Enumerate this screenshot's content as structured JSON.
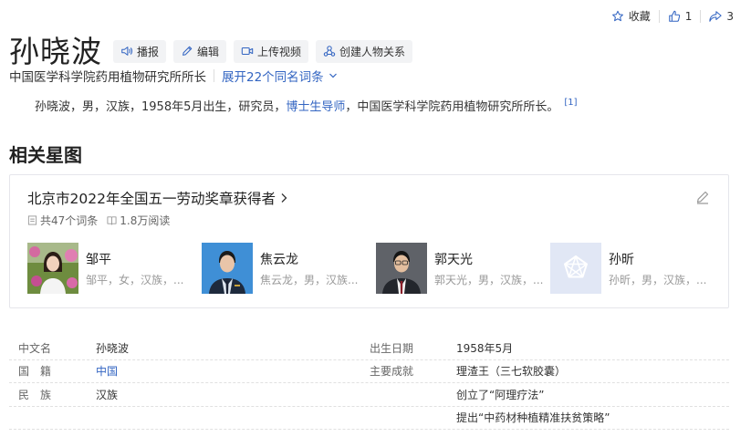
{
  "top_actions": {
    "favorite_label": "收藏",
    "like_count": "1",
    "share_count": "3"
  },
  "entry": {
    "title": "孙晓波",
    "subtitle": "中国医学科学院药用植物研究所所长",
    "expand_label": "展开22个同名词条"
  },
  "tools": [
    {
      "label": "播报",
      "icon": "speaker-icon"
    },
    {
      "label": "编辑",
      "icon": "pencil-icon"
    },
    {
      "label": "上传视频",
      "icon": "video-icon"
    },
    {
      "label": "创建人物关系",
      "icon": "relation-icon"
    }
  ],
  "summary": {
    "before": "孙晓波，男，汉族，1958年5月出生，研究员，",
    "link": "博士生导师",
    "after": "，中国医学科学院药用植物研究所所长。",
    "ref": "[1]"
  },
  "star_section": {
    "title": "相关星图",
    "card_title": "北京市2022年全国五一劳动奖章获得者",
    "entries_count": "共47个词条",
    "reads": "1.8万阅读",
    "persons": [
      {
        "name": "邹平",
        "desc": "邹平，女，汉族，..."
      },
      {
        "name": "焦云龙",
        "desc": "焦云龙，男，汉族..."
      },
      {
        "name": "郭天光",
        "desc": "郭天光，男，汉族，..."
      },
      {
        "name": "孙昕",
        "desc": "孙昕，男，汉族，..."
      }
    ]
  },
  "basic_info": {
    "rows": [
      {
        "k1": "中文名",
        "v1": "孙晓波",
        "k2": "出生日期",
        "v2": "1958年5月"
      },
      {
        "k1": "国　籍",
        "v1": "中国",
        "k2": "主要成就",
        "v2": "理渣王（三七软胶囊）"
      },
      {
        "k1": "民　族",
        "v1": "汉族",
        "k2": "",
        "v2": "创立了“阿理疗法”"
      },
      {
        "k1": "",
        "v1": "",
        "k2": "",
        "v2": "提出“中药材种植精准扶贫策略”"
      }
    ]
  },
  "colors": {
    "link": "#3365c2",
    "tool_bg": "#f2f3f5",
    "border": "#e5e6eb"
  }
}
